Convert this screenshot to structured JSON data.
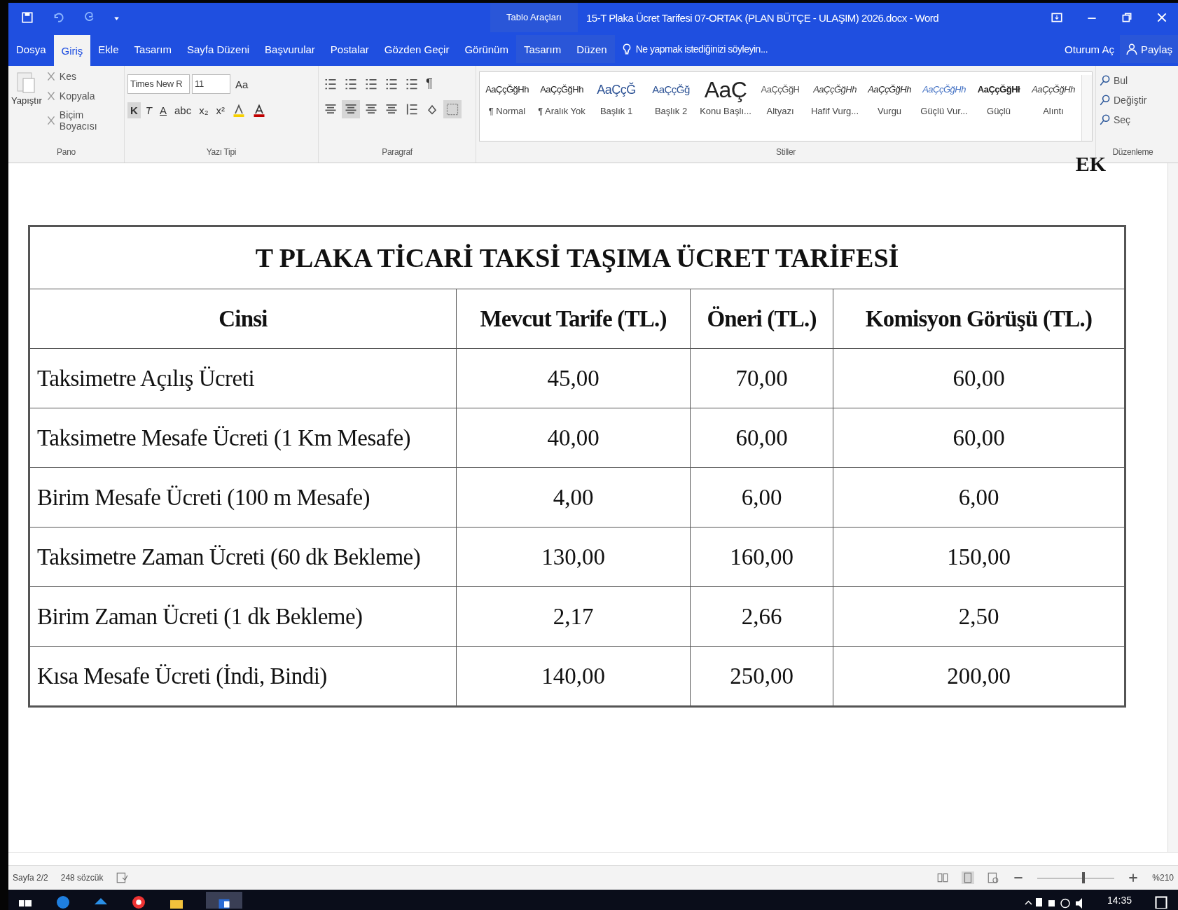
{
  "window": {
    "title": "15-T Plaka Ücret Tarifesi 07-ORTAK (PLAN BÜTÇE - ULAŞIM) 2026.docx - Word",
    "context_label": "Tablo Araçları"
  },
  "tabs": [
    {
      "label": "Dosya",
      "kind": "normal",
      "selected": false
    },
    {
      "label": "Giriş",
      "kind": "normal",
      "selected": true
    },
    {
      "label": "Ekle",
      "kind": "normal",
      "selected": false
    },
    {
      "label": "Tasarım",
      "kind": "normal",
      "selected": false
    },
    {
      "label": "Sayfa Düzeni",
      "kind": "normal",
      "selected": false
    },
    {
      "label": "Başvurular",
      "kind": "normal",
      "selected": false
    },
    {
      "label": "Postalar",
      "kind": "normal",
      "selected": false
    },
    {
      "label": "Gözden Geçir",
      "kind": "normal",
      "selected": false
    },
    {
      "label": "Görünüm",
      "kind": "normal",
      "selected": false
    },
    {
      "label": "Tasarım",
      "kind": "context",
      "selected": false
    },
    {
      "label": "Düzen",
      "kind": "context",
      "selected": false
    }
  ],
  "tell_me": "Ne yapmak istediğinizi söyleyin...",
  "sign_in": "Oturum Aç",
  "share": "Paylaş",
  "clipboard": {
    "group": "Pano",
    "paste": "Yapıştır",
    "items": [
      "Kes",
      "Kopyala",
      "Biçim Boyacısı"
    ]
  },
  "font": {
    "group": "Yazı Tipi",
    "name": "Times New R",
    "size": "11",
    "case": "Aa",
    "format_buttons": [
      "K",
      "T",
      "A",
      "abc",
      "x₂",
      "x²"
    ]
  },
  "paragraph": {
    "group": "Paragraf",
    "pilcrow": "¶"
  },
  "styles": {
    "group": "Stiller",
    "items": [
      {
        "sample": "AaÇçĞğHh",
        "name": "¶ Normal",
        "kind": "normal"
      },
      {
        "sample": "AaÇçĞğHh",
        "name": "¶ Aralık Yok",
        "kind": "normal"
      },
      {
        "sample": "AaÇçĞ",
        "name": "Başlık 1",
        "kind": "heading1"
      },
      {
        "sample": "AaÇçĞğ",
        "name": "Başlık 2",
        "kind": "heading2"
      },
      {
        "sample": "AaÇ",
        "name": "Konu Başlı...",
        "kind": "title"
      },
      {
        "sample": "AaÇçĞğH",
        "name": "Altyazı",
        "kind": "subtitle"
      },
      {
        "sample": "AaÇçĞğHh",
        "name": "Hafif Vurg...",
        "kind": "subtle"
      },
      {
        "sample": "AaÇçĞğHh",
        "name": "Vurgu",
        "kind": "emphasis"
      },
      {
        "sample": "AaÇçĞğHh",
        "name": "Güçlü Vur...",
        "kind": "intense"
      },
      {
        "sample": "AaÇçĞğHł",
        "name": "Güçlü",
        "kind": "strong"
      },
      {
        "sample": "AaÇçĞğHh",
        "name": "Alıntı",
        "kind": "subtle"
      }
    ]
  },
  "editing": {
    "group": "Düzenleme",
    "items": [
      "Bul",
      "Değiştir",
      "Seç"
    ]
  },
  "document": {
    "corner_text": "EK",
    "table": {
      "title": "T PLAKA TİCARİ TAKSİ TAŞIMA ÜCRET TARİFESİ",
      "columns": [
        "Cinsi",
        "Mevcut Tarife (TL.)",
        "Öneri (TL.)",
        "Komisyon Görüşü (TL.)"
      ],
      "rows": [
        [
          "Taksimetre Açılış Ücreti",
          "45,00",
          "70,00",
          "60,00"
        ],
        [
          "Taksimetre Mesafe Ücreti (1 Km Mesafe)",
          "40,00",
          "60,00",
          "60,00"
        ],
        [
          "Birim Mesafe Ücreti (100 m Mesafe)",
          "4,00",
          "6,00",
          "6,00"
        ],
        [
          "Taksimetre Zaman Ücreti (60 dk Bekleme)",
          "130,00",
          "160,00",
          "150,00"
        ],
        [
          "Birim Zaman Ücreti (1 dk Bekleme)",
          "2,17",
          "2,66",
          "2,50"
        ],
        [
          "Kısa Mesafe Ücreti (İndi, Bindi)",
          "140,00",
          "250,00",
          "200,00"
        ]
      ]
    }
  },
  "status_bar": {
    "page": "Sayfa 2/2",
    "words": "248 sözcük",
    "zoom": "%210",
    "zoom_slider": {
      "level": 0.6
    }
  },
  "taskbar": {
    "time": "14:35"
  }
}
